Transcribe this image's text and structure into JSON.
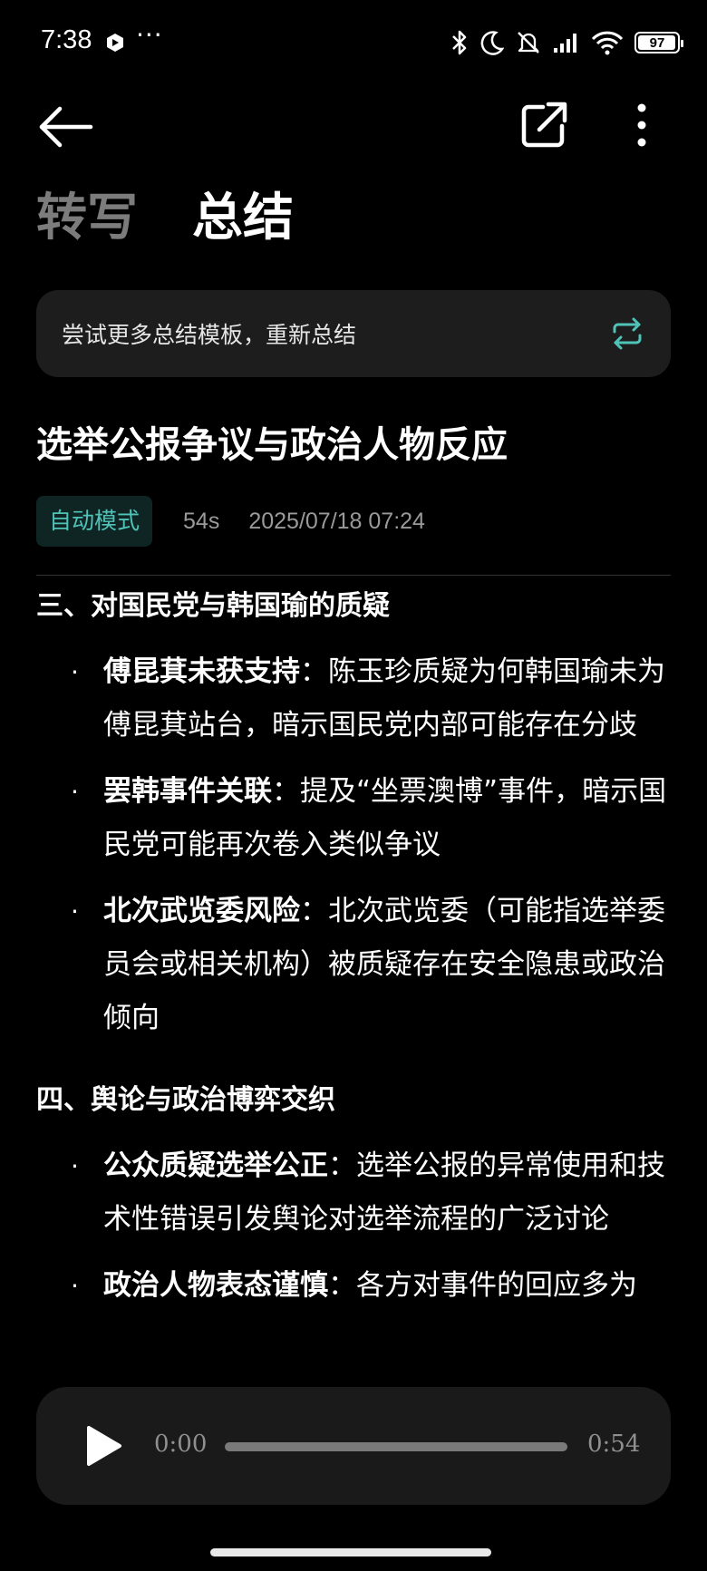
{
  "status_bar": {
    "time": "7:38",
    "dots": "···",
    "battery_level": "97",
    "icons": [
      "app-icon",
      "bluetooth-icon",
      "moon-icon",
      "mute-icon",
      "signal-icon",
      "wifi-icon",
      "battery-icon"
    ]
  },
  "header": {
    "back_icon": "arrow-left-icon",
    "share_icon": "share-icon",
    "more_icon": "more-vertical-icon"
  },
  "tabs": [
    {
      "label": "转写",
      "active": false
    },
    {
      "label": "总结",
      "active": true
    }
  ],
  "template_banner": {
    "text": "尝试更多总结模板，重新总结",
    "icon": "refresh-icon"
  },
  "document": {
    "title": "选举公报争议与政治人物反应",
    "mode": "自动模式",
    "duration": "54s",
    "datetime": "2025/07/18 07:24"
  },
  "sections": [
    {
      "heading": "三、对国民党与韩国瑜的质疑",
      "items": [
        {
          "key": "傅昆萁未获支持",
          "text": "：陈玉珍质疑为何韩国瑜未为傅昆萁站台，暗示国民党内部可能存在分歧"
        },
        {
          "key": "罢韩事件关联",
          "text": "：提及“坐票澳博”事件，暗示国民党可能再次卷入类似争议"
        },
        {
          "key": "北次武览委风险",
          "text": "：北次武览委（可能指选举委员会或相关机构）被质疑存在安全隐患或政治倾向"
        }
      ]
    },
    {
      "heading": "四、舆论与政治博弈交织",
      "items": [
        {
          "key": "公众质疑选举公正",
          "text": "：选举公报的异常使用和技术性错误引发舆论对选举流程的广泛讨论"
        },
        {
          "key": "政治人物表态谨慎",
          "text": "：各方对事件的回应多为"
        }
      ]
    }
  ],
  "player": {
    "play_icon": "play-icon",
    "current_time": "0:00",
    "total_time": "0:54",
    "progress": 0
  },
  "colors": {
    "background": "#000000",
    "card": "#1d1d1d",
    "accent": "#4fc3b8",
    "muted": "#9a9a9a"
  }
}
